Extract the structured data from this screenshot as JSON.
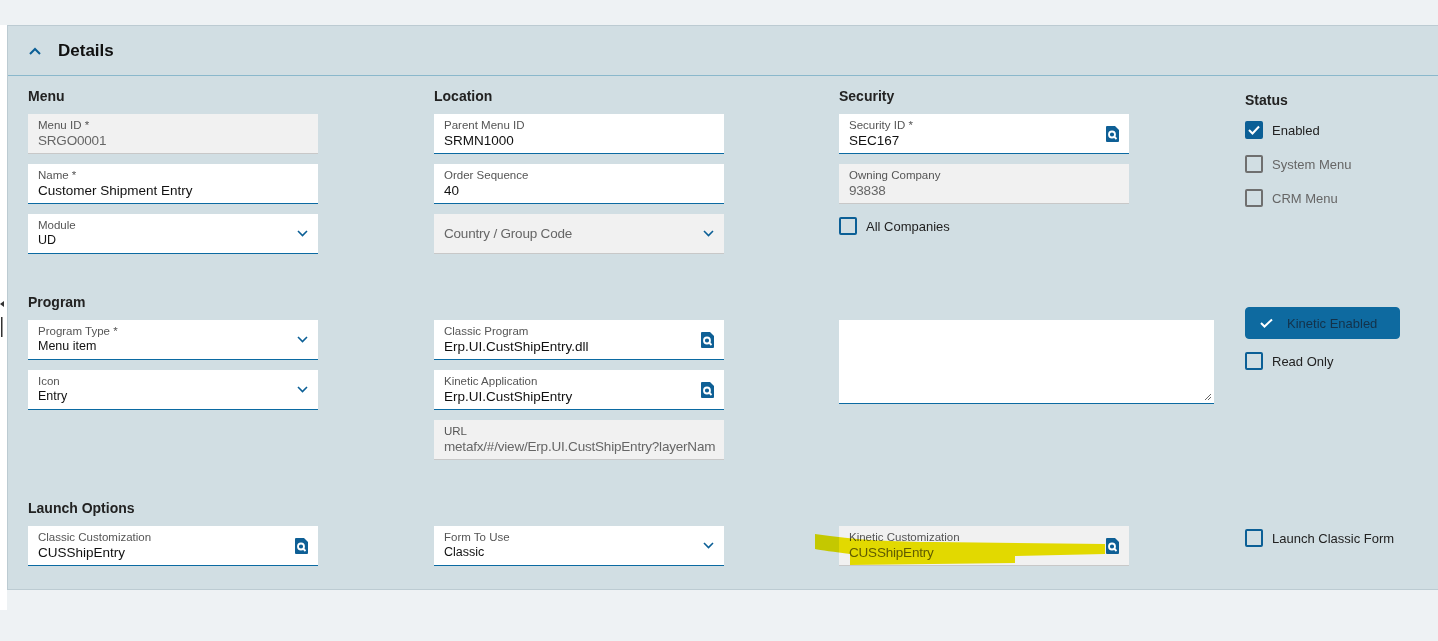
{
  "panel": {
    "title": "Details",
    "expanded": true
  },
  "rows": [
    {
      "columns": [
        {
          "heading": "Menu",
          "items": [
            {
              "kind": "input",
              "label": "Menu ID *",
              "value": "SRGO0001",
              "readonly": true
            },
            {
              "kind": "input",
              "label": "Name *",
              "value": "Customer Shipment Entry",
              "readonly": false
            },
            {
              "kind": "select",
              "label": "Module",
              "value": "UD",
              "readonly": false
            }
          ]
        },
        {
          "heading": "Location",
          "items": [
            {
              "kind": "input",
              "label": "Parent Menu ID",
              "value": "SRMN1000",
              "readonly": false
            },
            {
              "kind": "input",
              "label": "Order Sequence",
              "value": "40",
              "readonly": false
            },
            {
              "kind": "select",
              "placeholder": "Country / Group Code",
              "readonly": true
            }
          ]
        },
        {
          "heading": "Security",
          "items": [
            {
              "kind": "lookup",
              "label": "Security ID *",
              "value": "SEC167",
              "readonly": false
            },
            {
              "kind": "input",
              "label": "Owning Company",
              "value": "93838",
              "readonly": true
            },
            {
              "kind": "checkbox",
              "label": "All Companies",
              "checked": false,
              "disabled": false
            }
          ]
        },
        {
          "heading": "Status",
          "items": [
            {
              "kind": "checkbox",
              "label": "Enabled",
              "checked": true,
              "disabled": false
            },
            {
              "kind": "checkbox",
              "label": "System Menu",
              "checked": false,
              "disabled": true
            },
            {
              "kind": "checkbox",
              "label": "CRM Menu",
              "checked": false,
              "disabled": true
            }
          ]
        }
      ]
    },
    {
      "columns": [
        {
          "heading": "Program",
          "items": [
            {
              "kind": "select",
              "label": "Program Type *",
              "value": "Menu item",
              "readonly": false
            },
            {
              "kind": "select",
              "label": "Icon",
              "value": "Entry",
              "readonly": false
            }
          ]
        },
        {
          "items": [
            {
              "kind": "lookup",
              "label": "Classic Program",
              "value": "Erp.UI.CustShipEntry.dll",
              "readonly": false
            },
            {
              "kind": "lookup",
              "label": "Kinetic Application",
              "value": "Erp.UI.CustShipEntry",
              "readonly": false
            },
            {
              "kind": "input",
              "label": "URL",
              "value": "metafx/#/view/Erp.UI.CustShipEntry?layerNam",
              "readonly": true
            }
          ]
        },
        {
          "items": [
            {
              "kind": "textarea"
            }
          ]
        },
        {
          "items": [
            {
              "kind": "toggle",
              "label": "Kinetic Enabled",
              "selected": true
            },
            {
              "kind": "checkbox",
              "label": "Read Only",
              "checked": false,
              "disabled": false
            }
          ]
        }
      ]
    },
    {
      "columns": [
        {
          "heading": "Launch Options",
          "items": [
            {
              "kind": "lookup",
              "label": "Classic Customization",
              "value": "CUSShipEntry",
              "readonly": false
            }
          ]
        },
        {
          "items": [
            {
              "kind": "select",
              "label": "Form To Use",
              "value": "Classic",
              "readonly": false
            }
          ]
        },
        {
          "items": [
            {
              "kind": "lookup",
              "label": "Kinetic Customization",
              "value": "CUSShipEntry",
              "readonly": true,
              "highlighted": true
            }
          ]
        },
        {
          "items": [
            {
              "kind": "checkbox",
              "label": "Launch Classic Form",
              "checked": false,
              "disabled": false
            }
          ]
        }
      ]
    }
  ]
}
